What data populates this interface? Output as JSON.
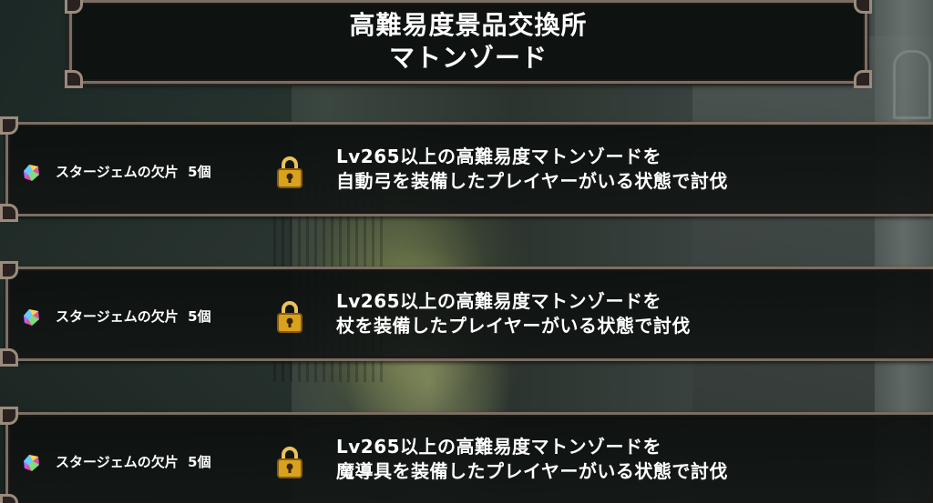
{
  "title": {
    "line1": "高難易度景品交換所",
    "line2": "マトンゾード"
  },
  "rewards": [
    {
      "item": "スタージェムの欠片",
      "quantity": "5個",
      "icon": "star-gem-fragment-icon",
      "status_icon": "padlock-icon",
      "condition_line1": "Lv265以上の高難易度マトンゾードを",
      "condition_line2": "自動弓を装備したプレイヤーがいる状態で討伐"
    },
    {
      "item": "スタージェムの欠片",
      "quantity": "5個",
      "icon": "star-gem-fragment-icon",
      "status_icon": "padlock-icon",
      "condition_line1": "Lv265以上の高難易度マトンゾードを",
      "condition_line2": "杖を装備したプレイヤーがいる状態で討伐"
    },
    {
      "item": "スタージェムの欠片",
      "quantity": "5個",
      "icon": "star-gem-fragment-icon",
      "status_icon": "padlock-icon",
      "condition_line1": "Lv265以上の高難易度マトンゾードを",
      "condition_line2": "魔導具を装備したプレイヤーがいる状態で討伐"
    }
  ],
  "colors": {
    "frame": "#7a6e63",
    "panel": "#0e1211",
    "text": "#ffffff",
    "lock_gold": "#d8a21e"
  }
}
